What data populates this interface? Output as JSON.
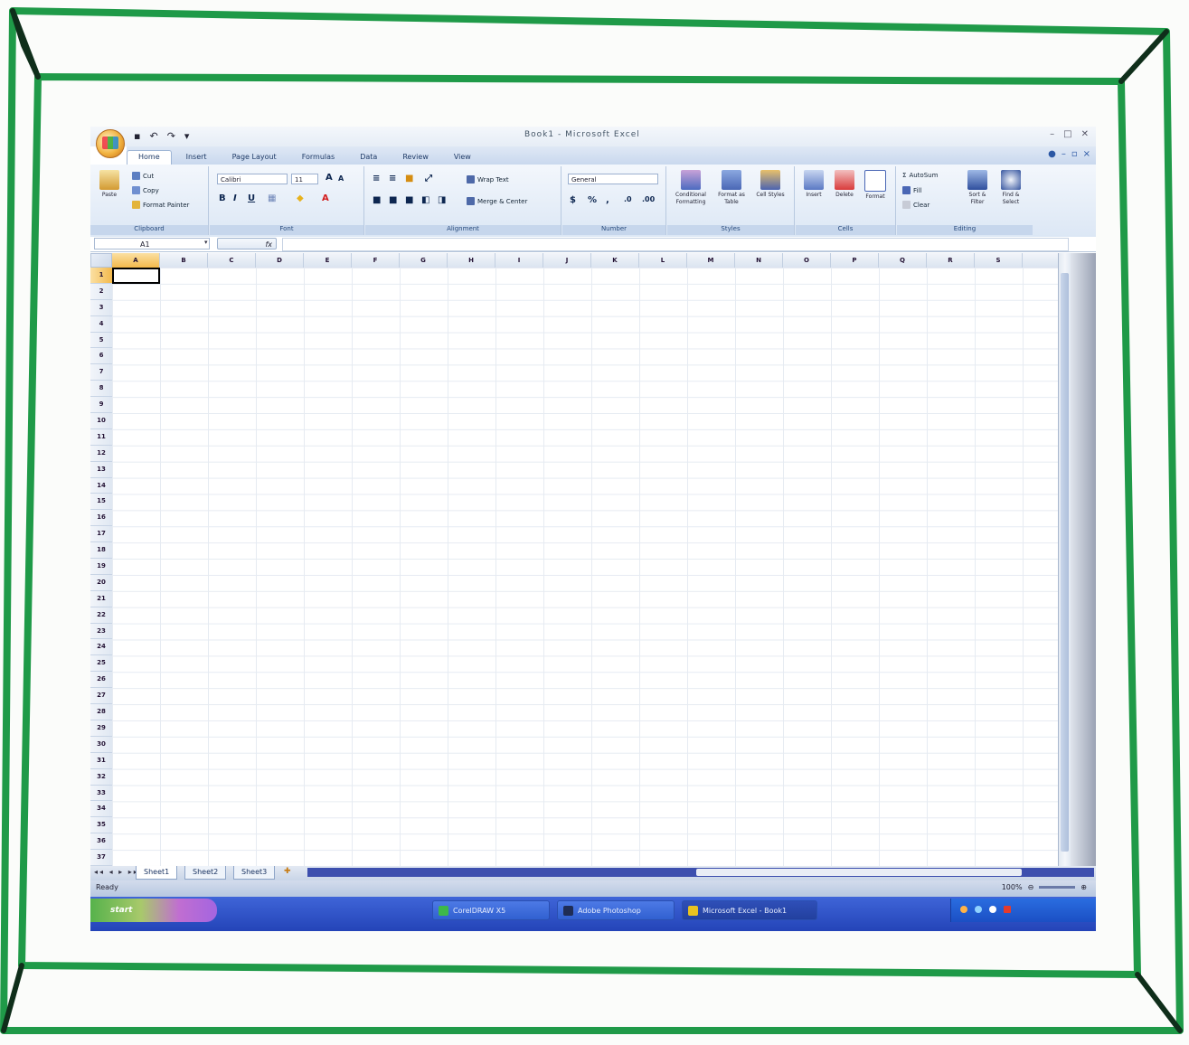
{
  "window": {
    "title": "Book1 - Microsoft Excel",
    "quick_access": [
      "▪",
      "↶",
      "↷",
      "▾"
    ],
    "controls": [
      "–",
      "□",
      "✕"
    ]
  },
  "ribbon": {
    "tabs": [
      "Home",
      "Insert",
      "Page Layout",
      "Formulas",
      "Data",
      "Review",
      "View"
    ],
    "active_tab": "Home",
    "clipboard": {
      "paste": "Paste",
      "cut": "Cut",
      "copy": "Copy",
      "format_painter": "Format Painter",
      "label": "Clipboard"
    },
    "font": {
      "name": "Calibri",
      "size": "11",
      "bold": "B",
      "italic": "I",
      "underline": "U",
      "label": "Font"
    },
    "alignment": {
      "wrap_text": "Wrap Text",
      "merge_center": "Merge & Center",
      "label": "Alignment"
    },
    "number": {
      "format": "General",
      "label": "Number"
    },
    "styles": {
      "conditional": "Conditional Formatting",
      "format_table": "Format as Table",
      "cell_styles": "Cell Styles",
      "label": "Styles"
    },
    "cells": {
      "insert": "Insert",
      "delete": "Delete",
      "format": "Format",
      "label": "Cells"
    },
    "editing": {
      "autosum": "AutoSum",
      "fill": "Fill",
      "clear": "Clear",
      "sort_filter": "Sort & Filter",
      "find_select": "Find & Select",
      "label": "Editing"
    }
  },
  "formula_bar": {
    "name_box": "A1",
    "fx": "fx",
    "value": ""
  },
  "grid": {
    "columns": [
      "A",
      "B",
      "C",
      "D",
      "E",
      "F",
      "G",
      "H",
      "I",
      "J",
      "K",
      "L",
      "M",
      "N",
      "O",
      "P",
      "Q",
      "R",
      "S"
    ],
    "rows": [
      "1",
      "2",
      "3",
      "4",
      "5",
      "6",
      "7",
      "8",
      "9",
      "10",
      "11",
      "12",
      "13",
      "14",
      "15",
      "16",
      "17",
      "18",
      "19",
      "20",
      "21",
      "22",
      "23",
      "24",
      "25",
      "26",
      "27",
      "28",
      "29",
      "30",
      "31",
      "32",
      "33",
      "34",
      "35",
      "36",
      "37"
    ],
    "active_cell": "A1"
  },
  "sheets": {
    "nav": "◂◂ ◂ ▸ ▸▸",
    "tabs": [
      "Sheet1",
      "Sheet2",
      "Sheet3"
    ],
    "active": "Sheet1"
  },
  "status": {
    "text": "Ready",
    "zoom": "100%"
  },
  "taskbar": {
    "start": "start",
    "buttons": [
      {
        "label": "CorelDRAW X5",
        "color": "#3db84a"
      },
      {
        "label": "Adobe Photoshop",
        "color": "#1f2d55"
      },
      {
        "label": "Microsoft Excel - Book1",
        "color": "#e8c21f"
      }
    ],
    "clock": ""
  },
  "colors": {
    "frame": "#1f9a48",
    "accent": "#f3b94c",
    "taskbar": "#2d4fc0"
  }
}
